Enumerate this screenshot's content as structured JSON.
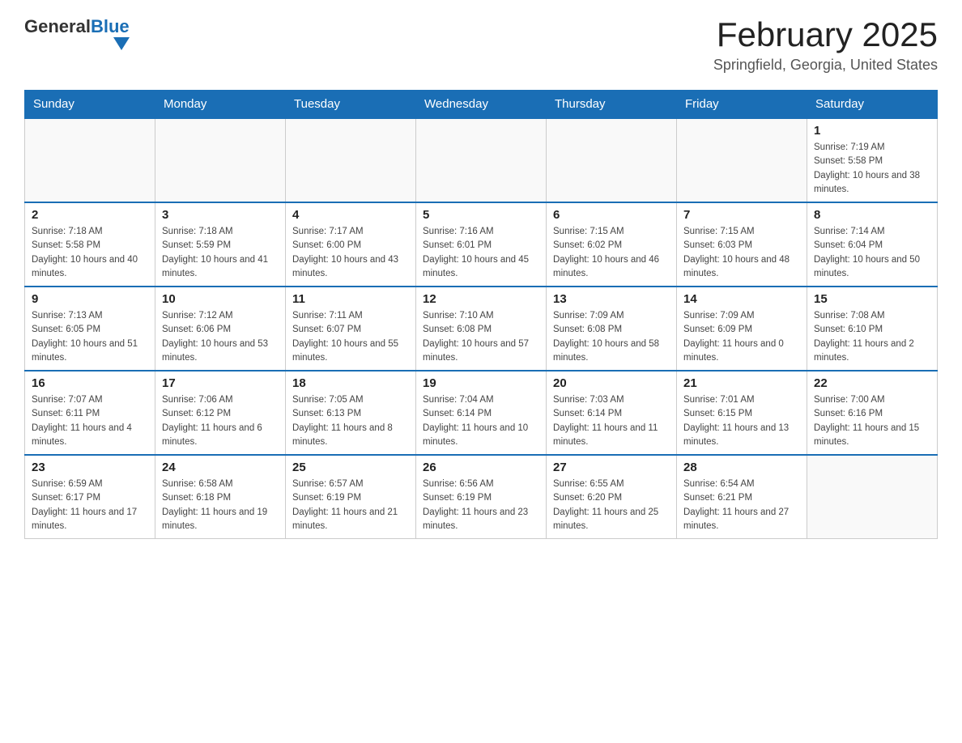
{
  "header": {
    "logo_general": "General",
    "logo_blue": "Blue",
    "title": "February 2025",
    "subtitle": "Springfield, Georgia, United States"
  },
  "weekdays": [
    "Sunday",
    "Monday",
    "Tuesday",
    "Wednesday",
    "Thursday",
    "Friday",
    "Saturday"
  ],
  "weeks": [
    [
      {
        "day": "",
        "info": ""
      },
      {
        "day": "",
        "info": ""
      },
      {
        "day": "",
        "info": ""
      },
      {
        "day": "",
        "info": ""
      },
      {
        "day": "",
        "info": ""
      },
      {
        "day": "",
        "info": ""
      },
      {
        "day": "1",
        "info": "Sunrise: 7:19 AM\nSunset: 5:58 PM\nDaylight: 10 hours and 38 minutes."
      }
    ],
    [
      {
        "day": "2",
        "info": "Sunrise: 7:18 AM\nSunset: 5:58 PM\nDaylight: 10 hours and 40 minutes."
      },
      {
        "day": "3",
        "info": "Sunrise: 7:18 AM\nSunset: 5:59 PM\nDaylight: 10 hours and 41 minutes."
      },
      {
        "day": "4",
        "info": "Sunrise: 7:17 AM\nSunset: 6:00 PM\nDaylight: 10 hours and 43 minutes."
      },
      {
        "day": "5",
        "info": "Sunrise: 7:16 AM\nSunset: 6:01 PM\nDaylight: 10 hours and 45 minutes."
      },
      {
        "day": "6",
        "info": "Sunrise: 7:15 AM\nSunset: 6:02 PM\nDaylight: 10 hours and 46 minutes."
      },
      {
        "day": "7",
        "info": "Sunrise: 7:15 AM\nSunset: 6:03 PM\nDaylight: 10 hours and 48 minutes."
      },
      {
        "day": "8",
        "info": "Sunrise: 7:14 AM\nSunset: 6:04 PM\nDaylight: 10 hours and 50 minutes."
      }
    ],
    [
      {
        "day": "9",
        "info": "Sunrise: 7:13 AM\nSunset: 6:05 PM\nDaylight: 10 hours and 51 minutes."
      },
      {
        "day": "10",
        "info": "Sunrise: 7:12 AM\nSunset: 6:06 PM\nDaylight: 10 hours and 53 minutes."
      },
      {
        "day": "11",
        "info": "Sunrise: 7:11 AM\nSunset: 6:07 PM\nDaylight: 10 hours and 55 minutes."
      },
      {
        "day": "12",
        "info": "Sunrise: 7:10 AM\nSunset: 6:08 PM\nDaylight: 10 hours and 57 minutes."
      },
      {
        "day": "13",
        "info": "Sunrise: 7:09 AM\nSunset: 6:08 PM\nDaylight: 10 hours and 58 minutes."
      },
      {
        "day": "14",
        "info": "Sunrise: 7:09 AM\nSunset: 6:09 PM\nDaylight: 11 hours and 0 minutes."
      },
      {
        "day": "15",
        "info": "Sunrise: 7:08 AM\nSunset: 6:10 PM\nDaylight: 11 hours and 2 minutes."
      }
    ],
    [
      {
        "day": "16",
        "info": "Sunrise: 7:07 AM\nSunset: 6:11 PM\nDaylight: 11 hours and 4 minutes."
      },
      {
        "day": "17",
        "info": "Sunrise: 7:06 AM\nSunset: 6:12 PM\nDaylight: 11 hours and 6 minutes."
      },
      {
        "day": "18",
        "info": "Sunrise: 7:05 AM\nSunset: 6:13 PM\nDaylight: 11 hours and 8 minutes."
      },
      {
        "day": "19",
        "info": "Sunrise: 7:04 AM\nSunset: 6:14 PM\nDaylight: 11 hours and 10 minutes."
      },
      {
        "day": "20",
        "info": "Sunrise: 7:03 AM\nSunset: 6:14 PM\nDaylight: 11 hours and 11 minutes."
      },
      {
        "day": "21",
        "info": "Sunrise: 7:01 AM\nSunset: 6:15 PM\nDaylight: 11 hours and 13 minutes."
      },
      {
        "day": "22",
        "info": "Sunrise: 7:00 AM\nSunset: 6:16 PM\nDaylight: 11 hours and 15 minutes."
      }
    ],
    [
      {
        "day": "23",
        "info": "Sunrise: 6:59 AM\nSunset: 6:17 PM\nDaylight: 11 hours and 17 minutes."
      },
      {
        "day": "24",
        "info": "Sunrise: 6:58 AM\nSunset: 6:18 PM\nDaylight: 11 hours and 19 minutes."
      },
      {
        "day": "25",
        "info": "Sunrise: 6:57 AM\nSunset: 6:19 PM\nDaylight: 11 hours and 21 minutes."
      },
      {
        "day": "26",
        "info": "Sunrise: 6:56 AM\nSunset: 6:19 PM\nDaylight: 11 hours and 23 minutes."
      },
      {
        "day": "27",
        "info": "Sunrise: 6:55 AM\nSunset: 6:20 PM\nDaylight: 11 hours and 25 minutes."
      },
      {
        "day": "28",
        "info": "Sunrise: 6:54 AM\nSunset: 6:21 PM\nDaylight: 11 hours and 27 minutes."
      },
      {
        "day": "",
        "info": ""
      }
    ]
  ]
}
